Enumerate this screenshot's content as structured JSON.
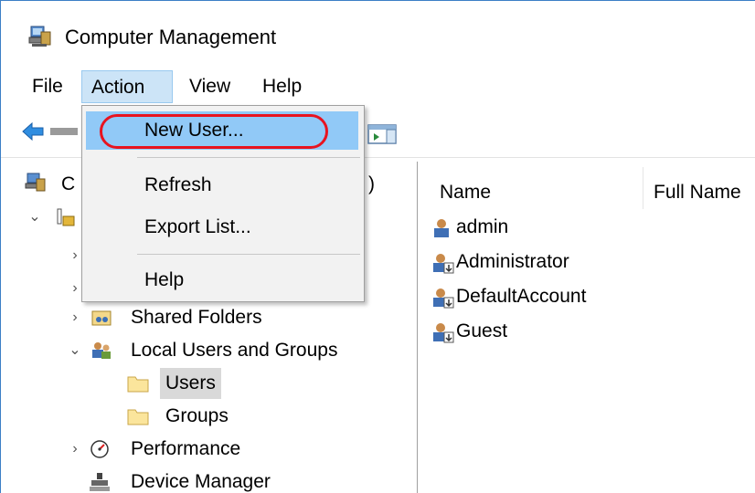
{
  "window": {
    "title": "Computer Management"
  },
  "menubar": {
    "items": [
      "File",
      "Action",
      "View",
      "Help"
    ],
    "open_menu": "Action"
  },
  "action_menu": {
    "items": [
      "New User...",
      "Refresh",
      "Export List...",
      "Help"
    ],
    "highlighted": "New User..."
  },
  "tree": {
    "root_partial": "C",
    "root_suffix": ")",
    "shared_folders": "Shared Folders",
    "local_users_groups": "Local Users and Groups",
    "users": "Users",
    "groups": "Groups",
    "performance": "Performance",
    "device_manager": "Device Manager"
  },
  "list": {
    "columns": [
      "Name",
      "Full Name"
    ],
    "rows": [
      "admin",
      "Administrator",
      "DefaultAccount",
      "Guest"
    ]
  },
  "colors": {
    "menu_open_bg": "#cce4f7",
    "menu_hover_bg": "#91c9f7",
    "highlight_ring": "#e8131f",
    "selected_tree_bg": "#d9d9d9"
  }
}
